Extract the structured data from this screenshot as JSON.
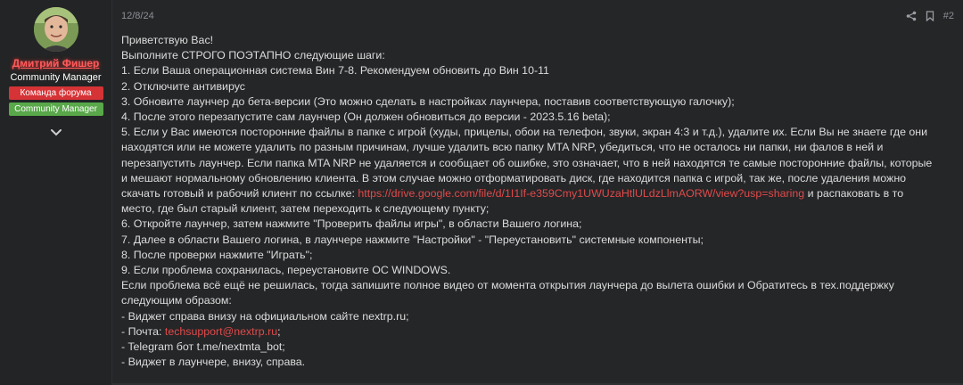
{
  "user": {
    "name": "Дмитрий Фишер",
    "title": "Community Manager",
    "banners": [
      "Команда форума",
      "Community Manager"
    ],
    "avatar_icon": "avatar-photo"
  },
  "post": {
    "date": "12/8/24",
    "number": "#2",
    "lines": [
      {
        "text": "Приветствую Вас!"
      },
      {
        "text": "Выполните СТРОГО ПОЭТАПНО следующие шаги:"
      },
      {
        "text": "1. Если Ваша операционная система Вин 7-8. Рекомендуем обновить до Вин 10-11"
      },
      {
        "text": "2. Отключите антивирус"
      },
      {
        "text": "3. Обновите лаунчер до бета-версии (Это можно сделать в настройках лаунчера, поставив соответствующую галочку);"
      },
      {
        "text": "4. После этого перезапустите сам лаунчер (Он должен обновиться до версии - 2023.5.16 beta);"
      },
      {
        "text": "5. Если у Вас имеются посторонние файлы в папке с игрой (худы, прицелы, обои на телефон, звуки, экран 4:3 и т.д.), удалите их. Если Вы не знаете где они"
      },
      {
        "text": "находятся или не можете удалить по разным причинам, лучше удалить всю папку MTA NRP, убедиться, что не осталось ни папки, ни фалов в ней и"
      },
      {
        "text": "перезапустить лаунчер. Если папка MTA NRP не удаляется и сообщает об ошибке, это означает, что в ней находятся те самые посторонние файлы, которые"
      },
      {
        "text": "и мешают нормальному обновлению клиента. В этом случае можно отформатировать диск, где находится папка с игрой, так же, после удаления можно"
      },
      {
        "pre": "скачать готовый и рабочий клиент по ссылке: ",
        "link": "https://drive.google.com/file/d/1I1If-e359Cmy1UWUzaHtlULdzLlmAORW/view?usp=sharing",
        "post": " и распаковать в то"
      },
      {
        "text": "место, где был старый клиент, затем переходить к следующему пункту;"
      },
      {
        "text": "6. Откройте лаунчер, затем нажмите \"Проверить файлы игры\", в области Вашего логина;"
      },
      {
        "text": "7. Далее в области Вашего логина, в лаунчере нажмите \"Настройки\" - \"Переустановить\" системные компоненты;"
      },
      {
        "text": "8. После проверки нажмите \"Играть\";"
      },
      {
        "text": "9. Если проблема сохранилась, переустановите ОС WINDOWS."
      },
      {
        "text": "Если проблема всё ещё не решилась, тогда запишите полное видео от момента открытия лаунчера до вылета ошибки и Обратитесь в тех.поддержку"
      },
      {
        "text": "следующим образом:"
      },
      {
        "text": "- Виджет справа внизу на официальном сайте nextrp.ru;"
      },
      {
        "pre": "- Почта: ",
        "link": "techsupport@nextrp.ru",
        "post": ";"
      },
      {
        "text": "- Telegram бот t.me/nextmta_bot;"
      },
      {
        "text": "- Виджет в лаунчере, внизу, справа."
      }
    ]
  },
  "colors": {
    "username": "#ff5a5a",
    "link": "#e04a4a",
    "banner_red": "#d53336",
    "banner_green": "#59a84a"
  }
}
